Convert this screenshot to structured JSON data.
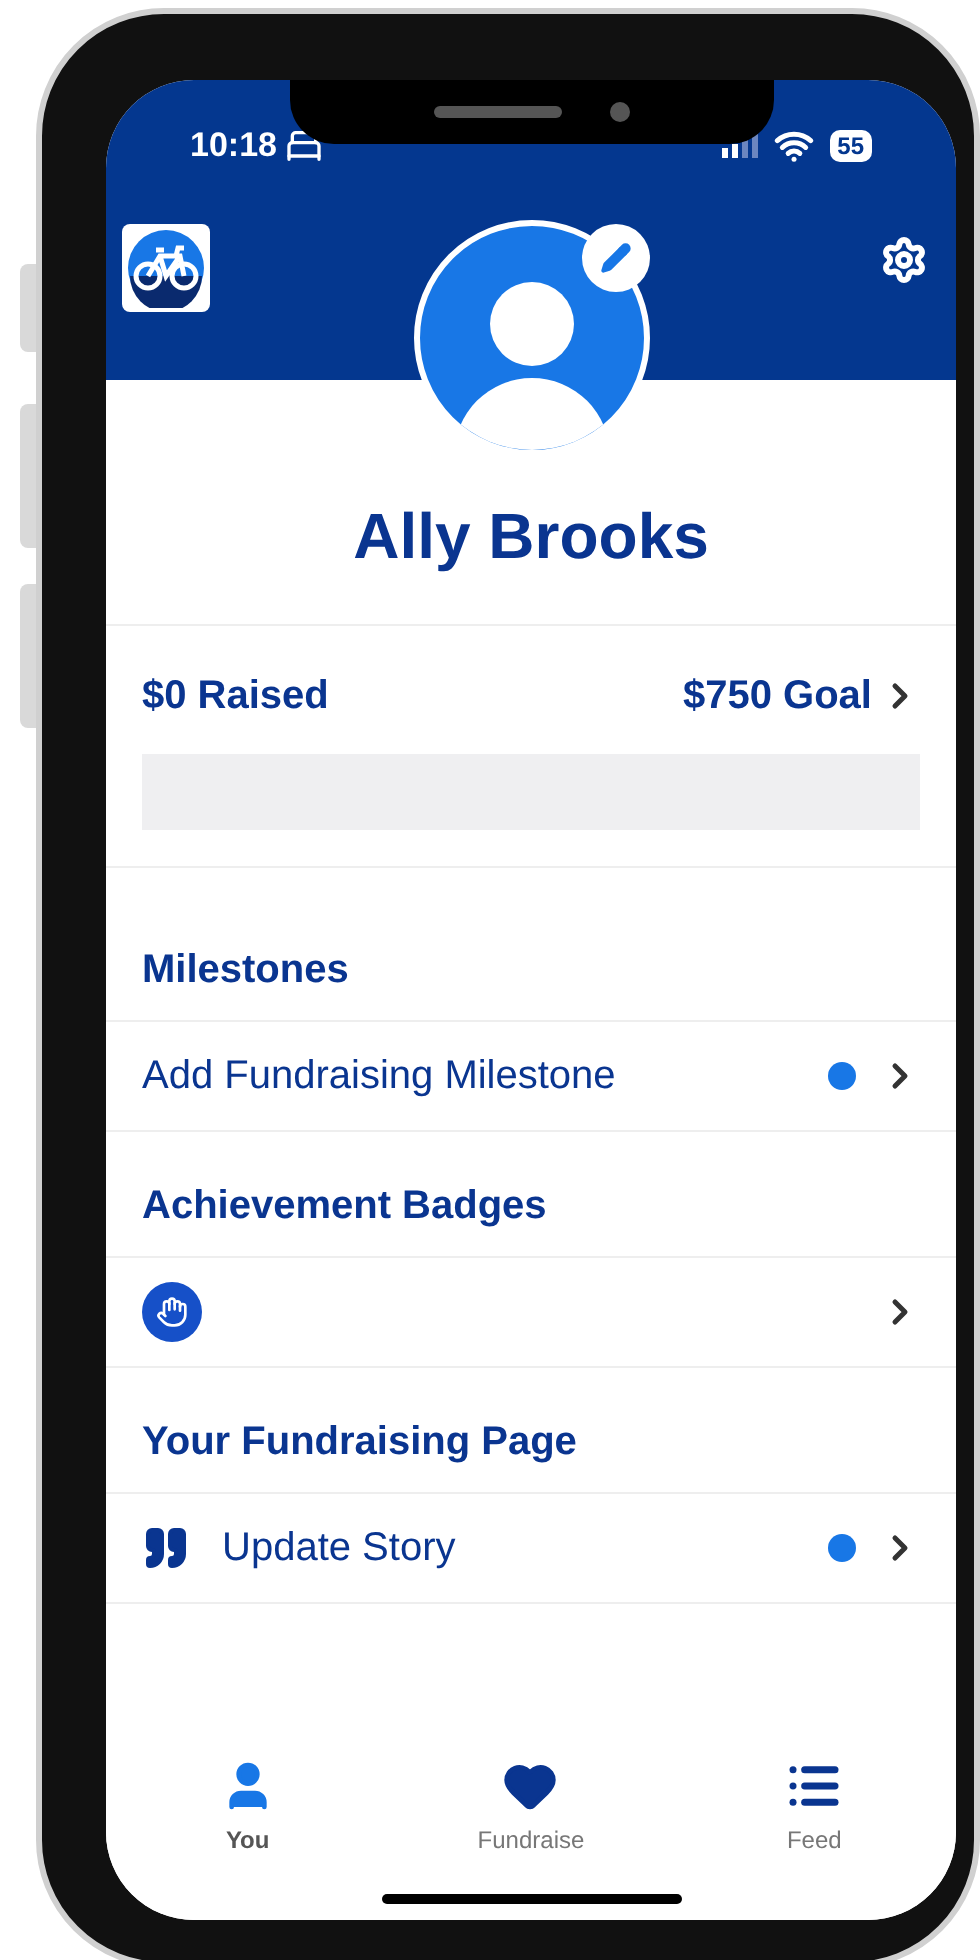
{
  "status_bar": {
    "time": "10:18",
    "battery": "55"
  },
  "profile": {
    "name": "Ally Brooks"
  },
  "fundraising": {
    "raised": "$0 Raised",
    "goal": "$750 Goal",
    "progress": {
      "level": 0
    }
  },
  "sections": [
    {
      "title": "Milestones",
      "rows": [
        {
          "kind": "text",
          "label": "Add Fundraising Milestone",
          "badge_dot": true
        }
      ]
    },
    {
      "title": "Achievement Badges",
      "rows": [
        {
          "kind": "badges",
          "badge_dot": false
        }
      ]
    },
    {
      "title": "Your Fundraising Page",
      "rows": [
        {
          "kind": "quote",
          "label": "Update Story",
          "badge_dot": true
        }
      ]
    }
  ],
  "tab_bar": [
    {
      "label": "You",
      "kind": "person",
      "selected": true
    },
    {
      "label": "Fundraise",
      "kind": "heart",
      "selected": false
    },
    {
      "label": "Feed",
      "kind": "list",
      "selected": false
    }
  ]
}
